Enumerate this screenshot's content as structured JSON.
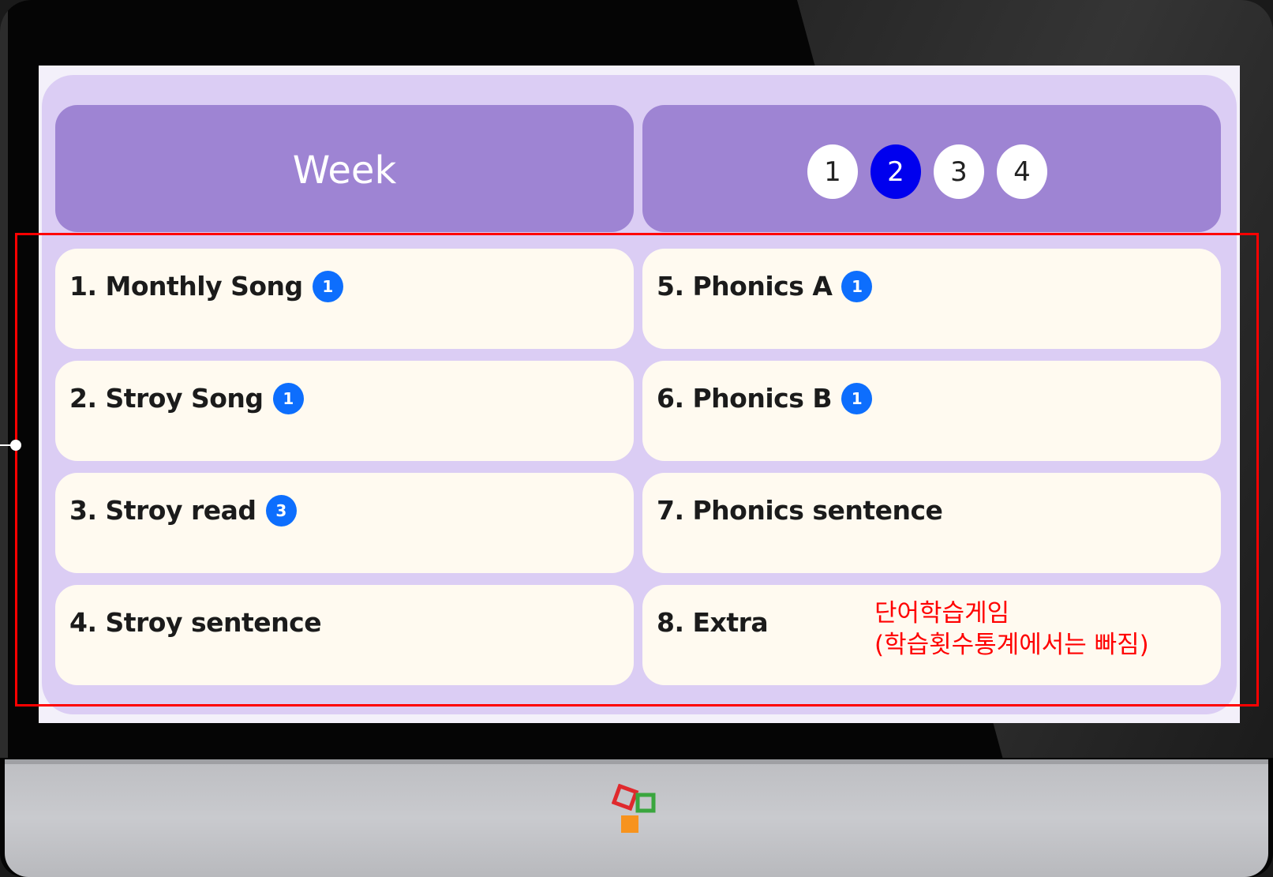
{
  "header": {
    "title": "Week",
    "weeks": [
      {
        "label": "1",
        "active": false
      },
      {
        "label": "2",
        "active": true
      },
      {
        "label": "3",
        "active": false
      },
      {
        "label": "4",
        "active": false
      }
    ]
  },
  "items": [
    {
      "label": "1. Monthly Song",
      "badge": "1"
    },
    {
      "label": "2. Stroy Song",
      "badge": "1"
    },
    {
      "label": "3. Stroy read",
      "badge": "3"
    },
    {
      "label": "4. Stroy sentence",
      "badge": ""
    },
    {
      "label": "5. Phonics A",
      "badge": "1"
    },
    {
      "label": "6. Phonics B",
      "badge": "1"
    },
    {
      "label": "7. Phonics sentence",
      "badge": ""
    },
    {
      "label": "8. Extra",
      "badge": ""
    }
  ],
  "annotation": {
    "line1": "단어학습게임",
    "line2": "(학습횟수통계에서는 빠짐)"
  },
  "colors": {
    "header_bg": "#9e84d3",
    "panel_bg": "#dbcdf4",
    "card_bg": "#fffaf0",
    "badge_bg": "#0d6efd",
    "active_week": "#0000ee",
    "annotation_red": "#ff0000"
  },
  "icons": {
    "brand_logo": "colored-squares-logo-icon"
  }
}
